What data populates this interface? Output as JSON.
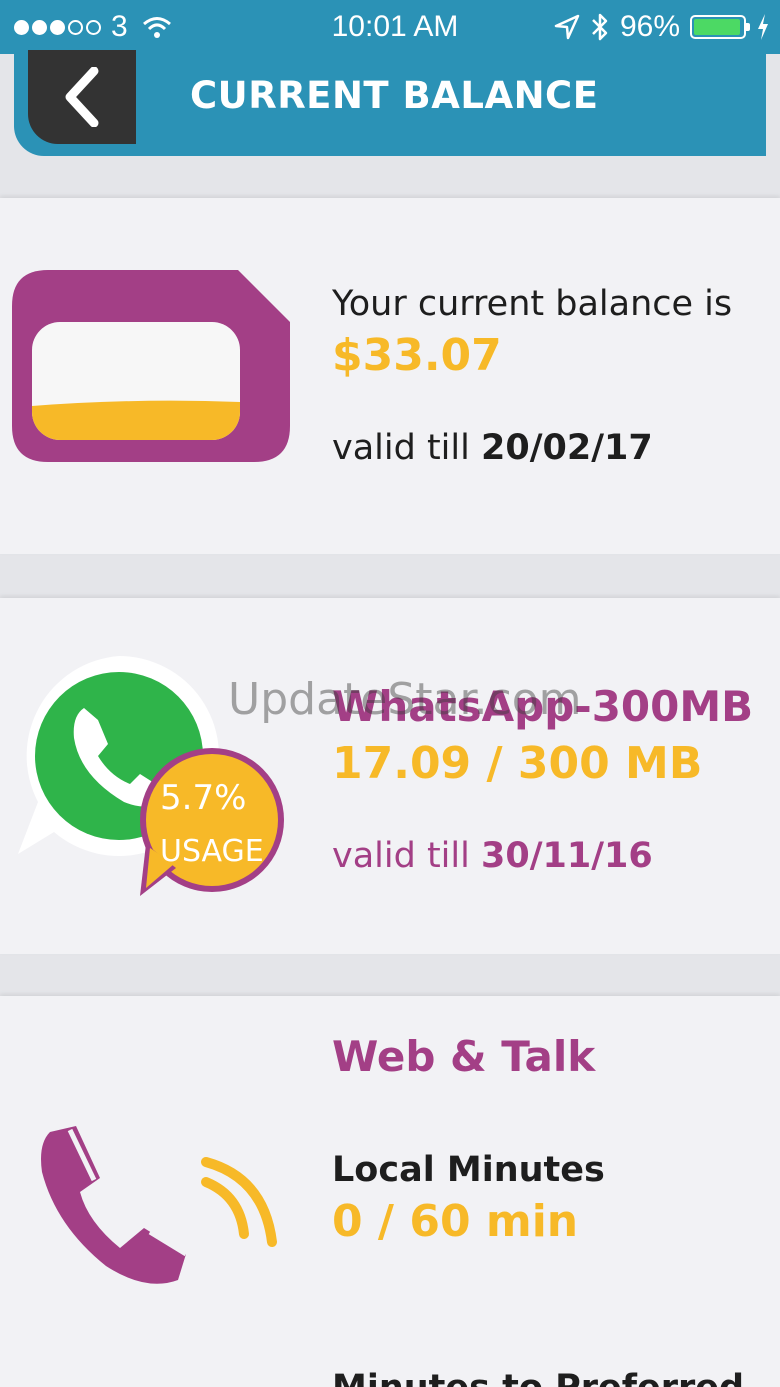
{
  "status_bar": {
    "carrier": "3",
    "time": "10:01 AM",
    "battery": "96%",
    "battery_level": 0.96
  },
  "header": {
    "title": "CURRENT BALANCE"
  },
  "balance": {
    "label": "Your current balance is",
    "amount": "$33.07",
    "valid_prefix": "valid till",
    "valid_date": "20/02/17"
  },
  "whatsapp": {
    "title": "WhatsApp-300MB",
    "usage": "17.09 / 300 MB",
    "badge_percent": "5.7%",
    "badge_label": "USAGE",
    "valid_prefix": "valid till",
    "valid_date": "30/11/16"
  },
  "web_talk": {
    "title": "Web & Talk",
    "local_label": "Local Minutes",
    "local_value": "0 / 60 min",
    "next_label": "Minutes to Preferred"
  },
  "watermark": "UpdateStar.com",
  "colors": {
    "header": "#2b92b6",
    "purple": "#a33f86",
    "orange": "#f7b928",
    "whatsapp_green": "#2fb44a"
  }
}
